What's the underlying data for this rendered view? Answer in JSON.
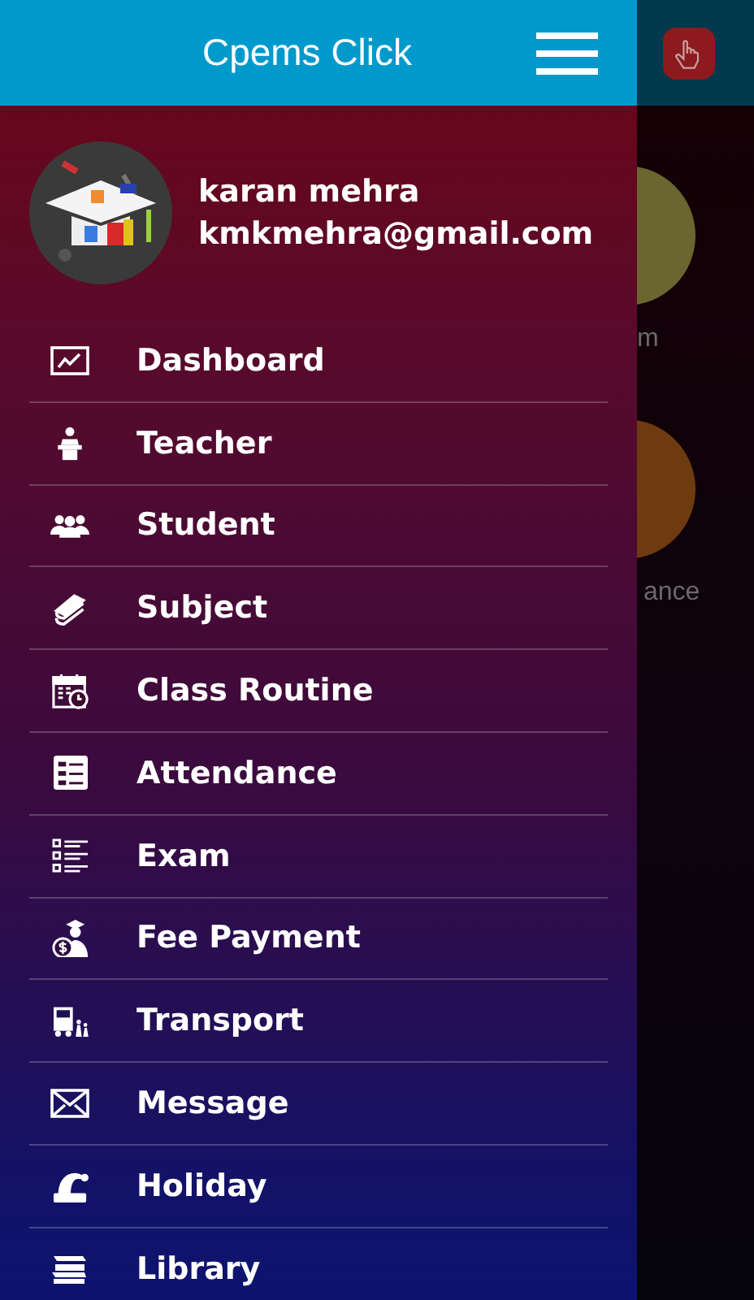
{
  "app_bar": {
    "title": "Cpems Click"
  },
  "profile": {
    "name": "karan mehra",
    "email": "kmkmehra@gmail.com"
  },
  "menu": [
    {
      "label": "Dashboard"
    },
    {
      "label": "Teacher"
    },
    {
      "label": "Student"
    },
    {
      "label": "Subject"
    },
    {
      "label": "Class Routine"
    },
    {
      "label": "Attendance"
    },
    {
      "label": "Exam"
    },
    {
      "label": "Fee Payment"
    },
    {
      "label": "Transport"
    },
    {
      "label": "Message"
    },
    {
      "label": "Holiday"
    },
    {
      "label": "Library"
    }
  ],
  "background": {
    "tiles": [
      {
        "label": "m",
        "color": "#6b6530"
      },
      {
        "label": "ance",
        "color": "#6e3a10"
      }
    ]
  }
}
